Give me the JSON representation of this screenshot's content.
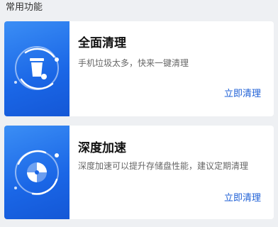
{
  "section": {
    "title": "常用功能"
  },
  "cards": [
    {
      "title": "全面清理",
      "description": "手机垃圾太多，快来一键清理",
      "action": "立即清理",
      "icon": "trash-icon"
    },
    {
      "title": "深度加速",
      "description": "深度加速可以提升存储盘性能，建议定期清理",
      "action": "立即清理",
      "icon": "speed-disc-icon"
    }
  ],
  "colors": {
    "accent": "#1d5fd6",
    "card_art": "#1a66e6",
    "background": "#eef0f3"
  }
}
